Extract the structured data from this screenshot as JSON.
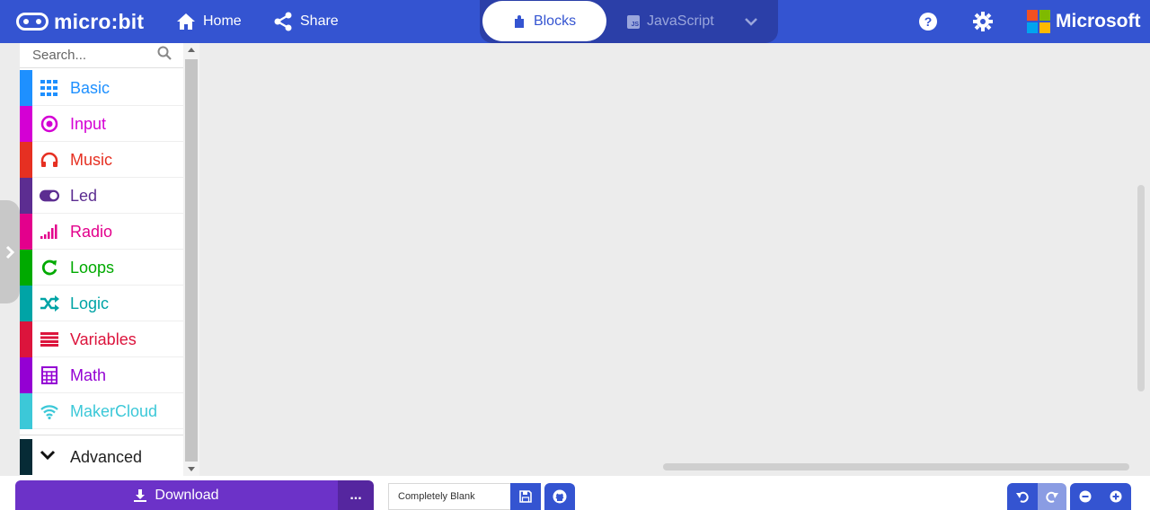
{
  "header": {
    "logo_text": "micro:bit",
    "home_label": "Home",
    "share_label": "Share",
    "tabs": [
      {
        "label": "Blocks",
        "icon": "puzzle-icon",
        "active": true
      },
      {
        "label": "JavaScript",
        "icon": "js-icon",
        "badge": "JS",
        "active": false
      }
    ],
    "brand": "Microsoft",
    "icons": [
      "home-icon",
      "share-icon",
      "help-icon",
      "gear-icon",
      "chevron-down-icon"
    ]
  },
  "toolbox": {
    "search_placeholder": "Search...",
    "categories": [
      {
        "label": "Basic",
        "color": "#1e90ff",
        "icon": "grid-icon"
      },
      {
        "label": "Input",
        "color": "#d400d4",
        "icon": "target-icon"
      },
      {
        "label": "Music",
        "color": "#e63022",
        "icon": "headphones-icon"
      },
      {
        "label": "Led",
        "color": "#5c2d91",
        "icon": "toggle-icon"
      },
      {
        "label": "Radio",
        "color": "#e3008c",
        "icon": "signal-icon"
      },
      {
        "label": "Loops",
        "color": "#00aa00",
        "icon": "refresh-icon"
      },
      {
        "label": "Logic",
        "color": "#00a4a6",
        "icon": "shuffle-icon"
      },
      {
        "label": "Variables",
        "color": "#dc143c",
        "icon": "list-icon"
      },
      {
        "label": "Math",
        "color": "#9400d3",
        "icon": "calculator-icon"
      },
      {
        "label": "MakerCloud",
        "color": "#3cc8d8",
        "icon": "wifi-icon"
      }
    ],
    "advanced_label": "Advanced"
  },
  "footer": {
    "download_label": "Download",
    "more_label": "...",
    "project_name": "Completely Blank"
  },
  "colors": {
    "header_bg": "#3454d1",
    "download_bg": "#6c32c8",
    "workspace_bg": "#ececec"
  }
}
